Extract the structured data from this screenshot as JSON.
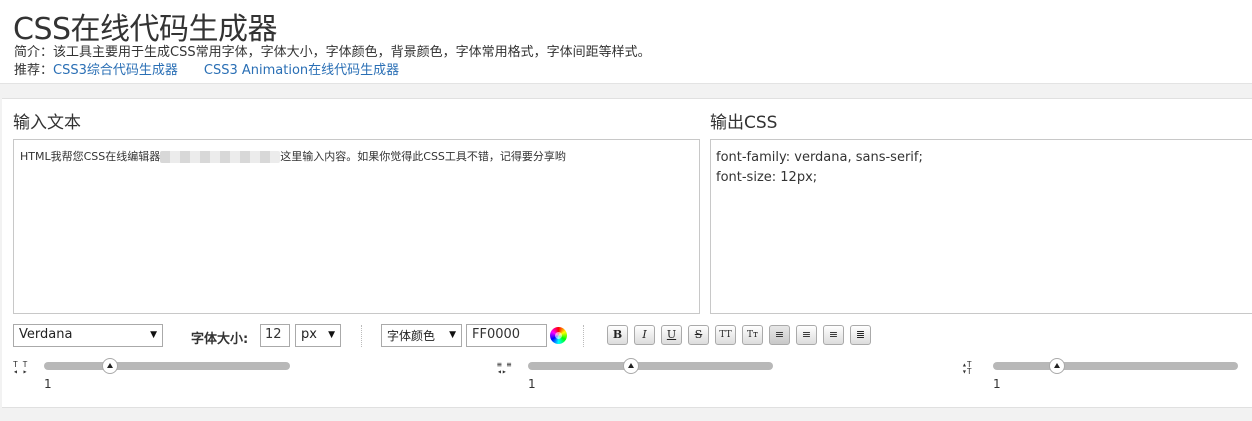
{
  "header": {
    "title": "CSS在线代码生成器",
    "intro": "简介：该工具主要用于生成CSS常用字体，字体大小，字体颜色，背景颜色，字体常用格式，字体间距等样式。",
    "rec_label": "推荐：",
    "rec_links": [
      "CSS3综合代码生成器",
      "CSS3 Animation在线代码生成器"
    ]
  },
  "input": {
    "title": "输入文本",
    "text_before": "HTML我帮您CSS在线编辑器",
    "text_after": "这里输入内容。如果你觉得此CSS工具不错，记得要分享哟"
  },
  "output": {
    "title": "输出CSS",
    "lines": [
      "font-family: verdana, sans-serif;",
      "font-size: 12px;"
    ]
  },
  "toolbar": {
    "font_family": "Verdana",
    "size_label": "字体大小:",
    "font_size": "12",
    "unit": "px",
    "color_label": "字体颜色",
    "color_value": "FF0000",
    "format_buttons": [
      {
        "name": "bold-button",
        "glyph": "B"
      },
      {
        "name": "italic-button",
        "glyph": "I"
      },
      {
        "name": "underline-button",
        "glyph": "U"
      },
      {
        "name": "strikethrough-button",
        "glyph": "S"
      },
      {
        "name": "uppercase-button",
        "glyph": "TT"
      },
      {
        "name": "small-caps-button",
        "glyph": "Tт"
      },
      {
        "name": "align-left-button",
        "glyph": "≡"
      },
      {
        "name": "align-center-button",
        "glyph": "≡"
      },
      {
        "name": "align-right-button",
        "glyph": "≡"
      },
      {
        "name": "justify-button",
        "glyph": "≣"
      }
    ]
  },
  "sliders": {
    "letter_spacing": {
      "value": "1",
      "level": 0.27
    },
    "word_spacing": {
      "value": "1",
      "level": 0.42
    },
    "line_height": {
      "value": "1",
      "level": 0.26
    }
  }
}
